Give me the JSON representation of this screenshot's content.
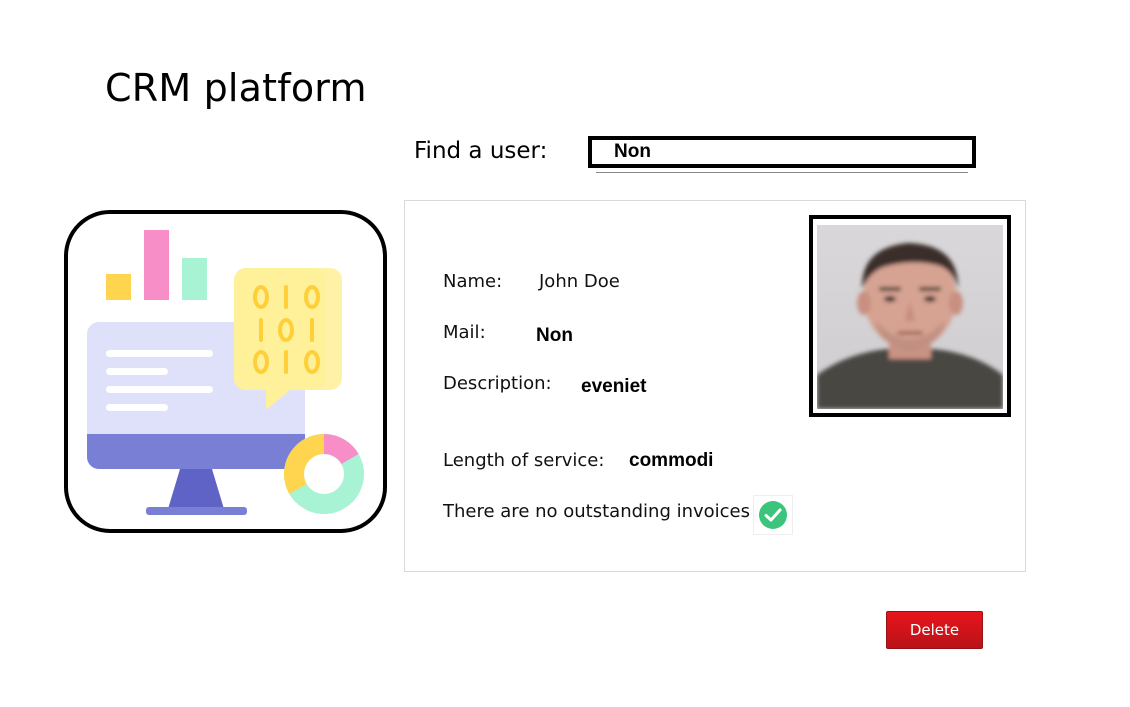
{
  "app": {
    "title": "CRM platform"
  },
  "search": {
    "label": "Find a user:",
    "value": "Non"
  },
  "illustration": {
    "icon": "crm-dashboard-illustration"
  },
  "user": {
    "name_label": "Name:",
    "name_value": "John Doe",
    "mail_label": "Mail:",
    "mail_value": "Non",
    "description_label": "Description:",
    "description_value": "eveniet",
    "service_label": "Length of service:",
    "service_value": "commodi",
    "invoices_text": "There are no outstanding invoices",
    "invoices_status_icon": "check-circle-icon",
    "photo": "user-portrait-photo"
  },
  "actions": {
    "delete_label": "Delete"
  },
  "colors": {
    "delete_button": "#d4151b",
    "check_green": "#3cc47c",
    "monitor_purple": "#7a7fd6",
    "chart_pink": "#f78ec7",
    "chart_yellow": "#ffd54f",
    "chart_mint": "#a8f3d3"
  }
}
